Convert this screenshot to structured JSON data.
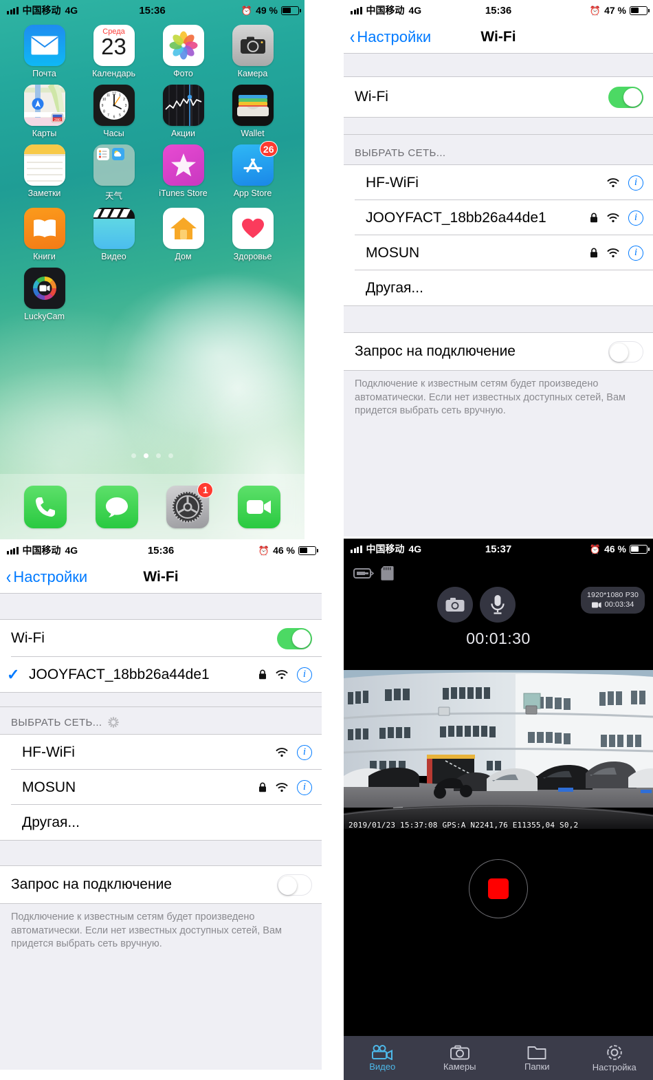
{
  "panels": {
    "home": {
      "status": {
        "carrier": "中国移动",
        "network": "4G",
        "time": "15:36",
        "battery": "49 %",
        "alarm_icon": "alarm-icon"
      },
      "apps": [
        [
          {
            "label": "Почта",
            "icon": "mail-icon"
          },
          {
            "label": "Календарь",
            "icon": "calendar-icon",
            "weekday": "Среда",
            "day": "23"
          },
          {
            "label": "Фото",
            "icon": "photos-icon"
          },
          {
            "label": "Камера",
            "icon": "camera-icon"
          }
        ],
        [
          {
            "label": "Карты",
            "icon": "maps-icon",
            "road": "280"
          },
          {
            "label": "Часы",
            "icon": "clock-icon"
          },
          {
            "label": "Акции",
            "icon": "stocks-icon"
          },
          {
            "label": "Wallet",
            "icon": "wallet-icon"
          }
        ],
        [
          {
            "label": "Заметки",
            "icon": "notes-icon"
          },
          {
            "label": "天气",
            "icon": "weather-folder-icon"
          },
          {
            "label": "iTunes Store",
            "icon": "itunes-store-icon"
          },
          {
            "label": "App Store",
            "icon": "app-store-icon",
            "badge": "26"
          }
        ],
        [
          {
            "label": "Книги",
            "icon": "ibooks-icon"
          },
          {
            "label": "Видео",
            "icon": "videos-icon"
          },
          {
            "label": "Дом",
            "icon": "home-icon"
          },
          {
            "label": "Здоровье",
            "icon": "health-icon"
          }
        ],
        [
          {
            "label": "LuckyCam",
            "icon": "luckycam-icon"
          }
        ]
      ],
      "page_dots": {
        "count": 4,
        "active_index": 1
      },
      "dock": [
        {
          "label": "Телефон",
          "icon": "phone-icon"
        },
        {
          "label": "Сообщения",
          "icon": "messages-icon"
        },
        {
          "label": "Настройки",
          "icon": "settings-gear-icon",
          "badge": "1"
        },
        {
          "label": "FaceTime",
          "icon": "facetime-icon"
        }
      ]
    },
    "wifi_scan": {
      "status": {
        "carrier": "中国移动",
        "network": "4G",
        "time": "15:36",
        "battery": "47 %",
        "alarm_icon": "alarm-icon"
      },
      "nav": {
        "back_label": "Настройки",
        "title": "Wi-Fi"
      },
      "wifi_row": {
        "label": "Wi-Fi",
        "toggle": "on"
      },
      "section_header": "ВЫБРАТЬ СЕТЬ...",
      "show_spinner": false,
      "networks": [
        {
          "ssid": "HF-WiFi",
          "locked": false,
          "signal": "wifi-icon",
          "info": "info-icon",
          "connected": false
        },
        {
          "ssid": "JOOYFACT_18bb26a44de1",
          "locked": true,
          "signal": "wifi-icon",
          "info": "info-icon",
          "connected": false
        },
        {
          "ssid": "MOSUN",
          "locked": true,
          "signal": "wifi-icon",
          "info": "info-icon",
          "connected": false
        }
      ],
      "other_label": "Другая...",
      "ask_row": {
        "label": "Запрос на подключение",
        "toggle": "off"
      },
      "footnote": "Подключение к известным сетям будет произведено автоматически. Если нет известных доступных сетей, Вам придется выбрать сеть вручную."
    },
    "wifi_connected": {
      "status": {
        "carrier": "中国移动",
        "network": "4G",
        "time": "15:36",
        "battery": "46 %",
        "alarm_icon": "alarm-icon"
      },
      "nav": {
        "back_label": "Настройки",
        "title": "Wi-Fi"
      },
      "wifi_row": {
        "label": "Wi-Fi",
        "toggle": "on"
      },
      "connected_network": {
        "ssid": "JOOYFACT_18bb26a44de1",
        "locked": true,
        "signal": "wifi-icon",
        "info": "info-icon",
        "connected": true,
        "check": "✓"
      },
      "section_header": "ВЫБРАТЬ СЕТЬ...",
      "show_spinner": true,
      "networks": [
        {
          "ssid": "HF-WiFi",
          "locked": false,
          "signal": "wifi-icon",
          "info": "info-icon",
          "connected": false
        },
        {
          "ssid": "MOSUN",
          "locked": true,
          "signal": "wifi-icon",
          "info": "info-icon",
          "connected": false
        }
      ],
      "other_label": "Другая...",
      "ask_row": {
        "label": "Запрос на подключение",
        "toggle": "off"
      },
      "footnote": "Подключение к известным сетям будет произведено автоматически. Если нет известных доступных сетей, Вам придется выбрать сеть вручную."
    },
    "dashcam": {
      "status": {
        "carrier": "中国移动",
        "network": "4G",
        "time": "15:37",
        "battery": "46 %",
        "alarm_icon": "alarm-icon"
      },
      "toolbar": [
        {
          "icon": "battery-status-icon"
        },
        {
          "icon": "sd-card-icon"
        }
      ],
      "controls": [
        {
          "icon": "snapshot-camera-icon"
        },
        {
          "icon": "microphone-icon"
        }
      ],
      "rec_badge": {
        "resolution": "1920*1080 P30",
        "duration": "00:03:34",
        "icon": "video-camera-icon"
      },
      "timer": "00:01:30",
      "osd": "2019/01/23 15:37:08 GPS:A N2241,76 E11355,04 S0,2",
      "record_button": {
        "state": "recording",
        "icon": "stop-square-icon"
      },
      "tabs": [
        {
          "label": "Видео",
          "icon": "video-camera-icon",
          "active": true
        },
        {
          "label": "Камеры",
          "icon": "camera-icon",
          "active": false
        },
        {
          "label": "Папки",
          "icon": "folder-icon",
          "active": false
        },
        {
          "label": "Настройка",
          "icon": "gear-icon",
          "active": false
        }
      ]
    }
  },
  "colors": {
    "ios_blue": "#007aff",
    "toggle_green": "#4cd964",
    "badge_red": "#ff3b30",
    "record_red": "#ff0000",
    "tab_active": "#4db8e8",
    "list_bg": "#efeff4"
  }
}
